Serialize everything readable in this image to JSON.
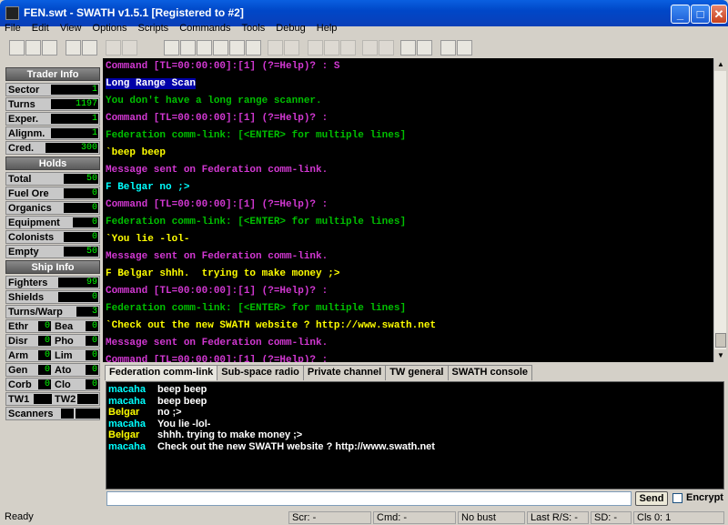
{
  "window": {
    "title": "FEN.swt - SWATH v1.5.1  [Registered to #2]",
    "minimize_glyph": "_",
    "maximize_glyph": "□",
    "close_glyph": "✕"
  },
  "menu": [
    "File",
    "Edit",
    "View",
    "Options",
    "Scripts",
    "Commands",
    "Tools",
    "Debug",
    "Help"
  ],
  "trader_info": {
    "header": "Trader Info",
    "rows": [
      {
        "label": "Sector",
        "value": "1"
      },
      {
        "label": "Turns",
        "value": "1197"
      },
      {
        "label": "Exper.",
        "value": "1"
      },
      {
        "label": "Alignm.",
        "value": "1"
      },
      {
        "label": "Cred.",
        "value": "300"
      }
    ]
  },
  "holds": {
    "header": "Holds",
    "rows": [
      {
        "label": "Total",
        "value": "50"
      },
      {
        "label": "Fuel Ore",
        "value": "0"
      },
      {
        "label": "Organics",
        "value": "0"
      },
      {
        "label": "Equipment",
        "value": "0"
      },
      {
        "label": "Colonists",
        "value": "0"
      },
      {
        "label": "Empty",
        "value": "50"
      }
    ]
  },
  "ship_info": {
    "header": "Ship Info",
    "rows": [
      {
        "label": "Fighters",
        "value": "99"
      },
      {
        "label": "Shields",
        "value": "0"
      },
      {
        "label": "Turns/Warp",
        "value": "3"
      }
    ],
    "pairs": [
      {
        "l1": "Ethr",
        "v1": "0",
        "l2": "Bea",
        "v2": "0"
      },
      {
        "l1": "Disr",
        "v1": "0",
        "l2": "Pho",
        "v2": "0"
      },
      {
        "l1": "Arm",
        "v1": "0",
        "l2": "Lim",
        "v2": "0"
      },
      {
        "l1": "Gen",
        "v1": "0",
        "l2": "Ato",
        "v2": "0"
      },
      {
        "l1": "Corb",
        "v1": "0",
        "l2": "Clo",
        "v2": "0"
      }
    ],
    "tw1": "TW1",
    "tw2": "TW2",
    "scanners": "Scanners"
  },
  "terminal": {
    "lines": [
      {
        "color": "#d238d2",
        "text": "Command [TL=00:00:00]:[1] (?=Help)? : S"
      },
      {
        "color": "#ffffff",
        "text": "Long Range Scan",
        "highlight": true
      },
      {
        "color": "#00c000",
        "text": "You don't have a long range scanner."
      },
      {
        "color": "#d238d2",
        "text": "Command [TL=00:00:00]:[1] (?=Help)? :"
      },
      {
        "color": "#00c000",
        "text": "Federation comm-link: [<ENTER> for multiple lines]"
      },
      {
        "color": "#ffff00",
        "text": "`beep beep"
      },
      {
        "color": "#d238d2",
        "text": "Message sent on Federation comm-link."
      },
      {
        "color": "#00ffff",
        "text": "F Belgar no ;>"
      },
      {
        "color": "#d238d2",
        "text": "Command [TL=00:00:00]:[1] (?=Help)? :"
      },
      {
        "color": "#00c000",
        "text": "Federation comm-link: [<ENTER> for multiple lines]"
      },
      {
        "color": "#ffff00",
        "text": "`You lie -lol-"
      },
      {
        "color": "#d238d2",
        "text": "Message sent on Federation comm-link."
      },
      {
        "color": "#ffff00",
        "text": "F Belgar shhh.  trying to make money ;>"
      },
      {
        "color": "#d238d2",
        "text": "Command [TL=00:00:00]:[1] (?=Help)? :"
      },
      {
        "color": "#00c000",
        "text": "Federation comm-link: [<ENTER> for multiple lines]"
      },
      {
        "color": "#ffff00",
        "text": "`Check out the new SWATH website ? http://www.swath.net"
      },
      {
        "color": "#d238d2",
        "text": "Message sent on Federation comm-link."
      },
      {
        "color": "#d238d2",
        "text": "Command [TL=00:00:00]:[1] (?=Help)? : _"
      }
    ]
  },
  "tabs": [
    "Federation comm-link",
    "Sub-space radio",
    "Private channel",
    "TW general",
    "SWATH console"
  ],
  "chat": [
    {
      "who": "macaha",
      "color": "#00ffff",
      "msg": "beep beep"
    },
    {
      "who": "macaha",
      "color": "#00ffff",
      "msg": "beep beep"
    },
    {
      "who": "Belgar",
      "color": "#ffff00",
      "msg": "no ;>"
    },
    {
      "who": "macaha",
      "color": "#00ffff",
      "msg": "You lie -lol-"
    },
    {
      "who": "Belgar",
      "color": "#ffff00",
      "msg": "shhh.  trying to make money ;>"
    },
    {
      "who": "macaha",
      "color": "#00ffff",
      "msg": "Check out the new SWATH website ? http://www.swath.net"
    }
  ],
  "send_label": "Send",
  "encrypt_label": "Encrypt",
  "status": {
    "ready": "Ready",
    "scr": "Scr: -",
    "cmd": "Cmd: -",
    "bust": "No bust",
    "last_rs": "Last R/S: -",
    "sd": "SD: -",
    "cls": "Cls 0: 1"
  }
}
